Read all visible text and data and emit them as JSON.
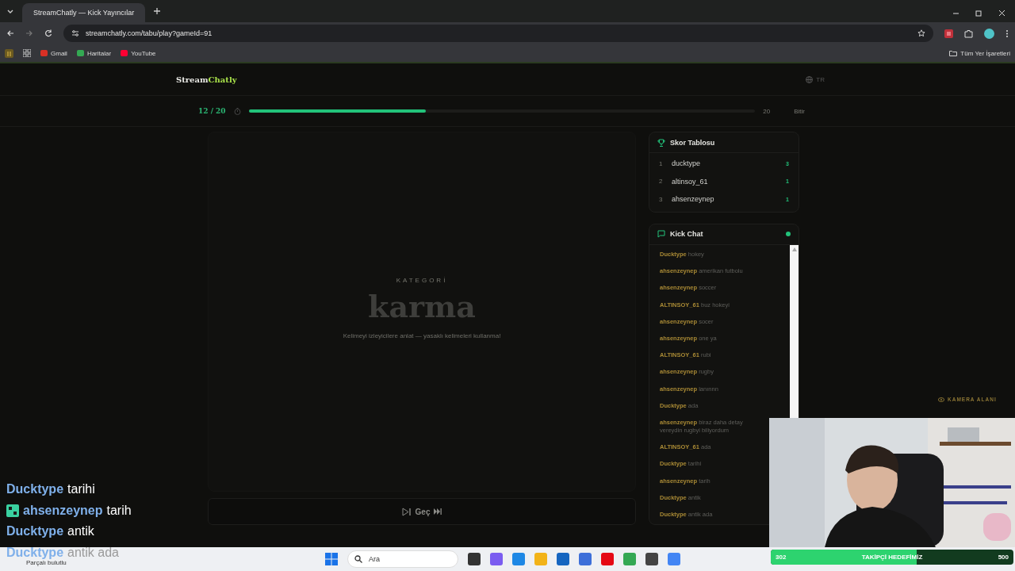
{
  "browser": {
    "tab_title": "StreamChatly — Kick Yayıncılar",
    "url": "streamchatly.com/tabu/play?gameId=91",
    "bookmarks": [
      "Gmail",
      "Haritalar",
      "YouTube"
    ],
    "all_bookmarks": "Tüm Yer İşaretleri"
  },
  "header": {
    "logo_first": "Stream",
    "logo_second": "Chatly",
    "language": "TR"
  },
  "progress": {
    "round": "12 / 20",
    "level": 0.35,
    "total": "20",
    "finish": "Bitir"
  },
  "card": {
    "label": "KATEGORİ",
    "word": "karma",
    "hint": "Kelimeyi izleyicilere anlat — yasaklı kelimeleri kullanma!",
    "skip": "Geç"
  },
  "scoreboard": {
    "title": "Skor Tablosu",
    "rows": [
      {
        "rank": "1",
        "name": "ducktype",
        "score": "3"
      },
      {
        "rank": "2",
        "name": "altinsoy_61",
        "score": "1"
      },
      {
        "rank": "3",
        "name": "ahsenzeynep",
        "score": "1"
      }
    ]
  },
  "chat": {
    "title": "Kick Chat",
    "live": true,
    "messages": [
      {
        "user": "Ducktype",
        "text": "hokey"
      },
      {
        "user": "ahsenzeynep",
        "text": "amerikan futbolu"
      },
      {
        "user": "ahsenzeynep",
        "text": "soccer"
      },
      {
        "user": "ALTINSOY_61",
        "text": "buz hokeyi"
      },
      {
        "user": "ahsenzeynep",
        "text": "socer"
      },
      {
        "user": "ahsenzeynep",
        "text": "one ya"
      },
      {
        "user": "ALTINSOY_61",
        "text": "rubi"
      },
      {
        "user": "ahsenzeynep",
        "text": "rugby"
      },
      {
        "user": "ahsenzeynep",
        "text": "lanınnn"
      },
      {
        "user": "Ducktype",
        "text": "ada"
      },
      {
        "user": "ahsenzeynep",
        "text": "biraz daha detay vereydin rugbyi biliyordum"
      },
      {
        "user": "ALTINSOY_61",
        "text": "ada"
      },
      {
        "user": "Ducktype",
        "text": "tarihi"
      },
      {
        "user": "ahsenzeynep",
        "text": "tarih"
      },
      {
        "user": "Ducktype",
        "text": "antik"
      },
      {
        "user": "Ducktype",
        "text": "antik ada"
      }
    ]
  },
  "camera_label": "KAMERA ALANI",
  "stream_chat": [
    {
      "user": "Ducktype",
      "text": "tarihi",
      "badge": false,
      "faded": false
    },
    {
      "user": "ahsenzeynep",
      "text": "tarih",
      "badge": true,
      "faded": false
    },
    {
      "user": "Ducktype",
      "text": "antik",
      "badge": false,
      "faded": false
    },
    {
      "user": "Ducktype",
      "text": "antik ada",
      "badge": false,
      "faded": true
    }
  ],
  "goal": {
    "current": "302",
    "label": "TAKİPÇİ HEDEFİMİZ",
    "target": "500",
    "level": 0.6
  },
  "taskbar": {
    "weather": "Parçalı bulutlu",
    "search": "Ara"
  }
}
